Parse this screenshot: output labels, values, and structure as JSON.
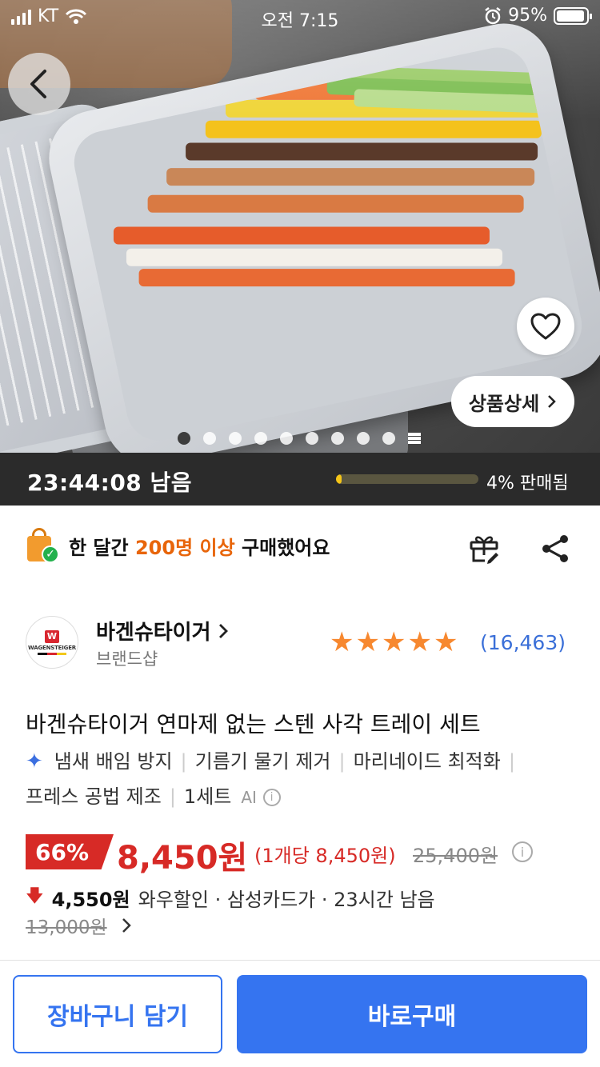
{
  "status_bar": {
    "carrier": "KT",
    "time": "오전 7:15",
    "battery": "95%",
    "battery_level": 0.95
  },
  "hero": {
    "slide_count": 10,
    "active_slide": 1,
    "detail_button": "상품상세"
  },
  "timer": {
    "remaining": "23:44:08 남음",
    "sold_label": "4% 판매됨",
    "sold_fraction": 0.04
  },
  "proof": {
    "prefix": "한 달간",
    "highlight": "200명 이상",
    "suffix": "구매했어요"
  },
  "seller": {
    "name": "바겐슈타이거",
    "type": "브랜드샵",
    "logo_text": "WAGENSTEIGER",
    "rating": 5,
    "review_count": "(16,463)"
  },
  "product": {
    "title": "바겐슈타이거 연마제 없는 스텐 사각 트레이 세트",
    "attributes": [
      "냄새 배임 방지",
      "기름기 물기 제거",
      "마리네이드 최적화",
      "프레스 공법 제조",
      "1세트"
    ],
    "ai_label": "AI"
  },
  "price": {
    "discount": "66%",
    "sale": "8,450원",
    "unit": "(1개당 8,450원)",
    "original": "25,400원",
    "wow_amount": "4,550원",
    "wow_desc": "와우할인 · 삼성카드가 · 23시간 남음",
    "wow_original": "13,000원"
  },
  "actions": {
    "cart": "장바구니 담기",
    "buy": "바로구매"
  },
  "colors": {
    "accent_blue": "#3574f0",
    "sale_red": "#d72a26",
    "highlight_orange": "#e8650a",
    "star_orange": "#f7882f"
  }
}
